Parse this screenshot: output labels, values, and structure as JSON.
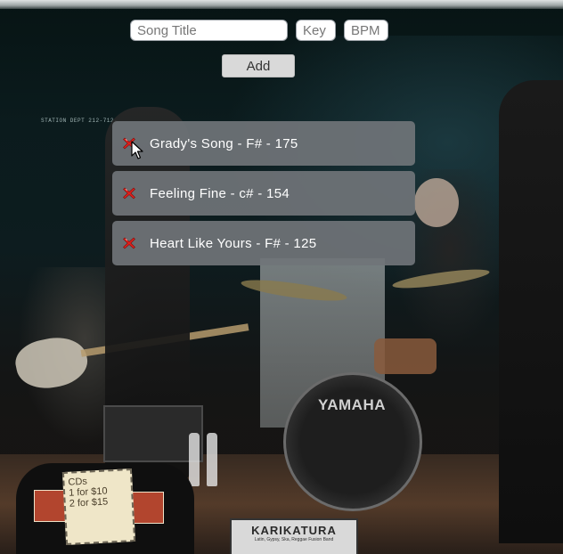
{
  "form": {
    "title_placeholder": "Song Title",
    "key_placeholder": "Key",
    "bpm_placeholder": "BPM",
    "add_label": "Add"
  },
  "songs": [
    {
      "title": "Grady's Song",
      "key": "F#",
      "bpm": "175",
      "display": "Grady's Song - F# - 175"
    },
    {
      "title": "Feeling Fine",
      "key": "c#",
      "bpm": "154",
      "display": "Feeling Fine - c# - 154"
    },
    {
      "title": "Heart Like Yours",
      "key": "F#",
      "bpm": "125",
      "display": "Heart Like Yours - F# - 125"
    }
  ],
  "background": {
    "station_text": "STATION DEPT 212-712-...",
    "drum_brand": "YAMAHA",
    "cd_sign_lines": [
      "CDs",
      "1 for $10",
      "2 for $15"
    ],
    "sign_title": "KARIKATURA",
    "sign_subtitle": "Latin, Gypsy, Ska, Reggae Fusion Band"
  },
  "colors": {
    "card": "#707478",
    "delete_icon": "#e0201c",
    "add_button": "#d9d9d9"
  },
  "icons": {
    "delete": "red-x-delete-icon",
    "cursor": "mouse-pointer-icon"
  }
}
